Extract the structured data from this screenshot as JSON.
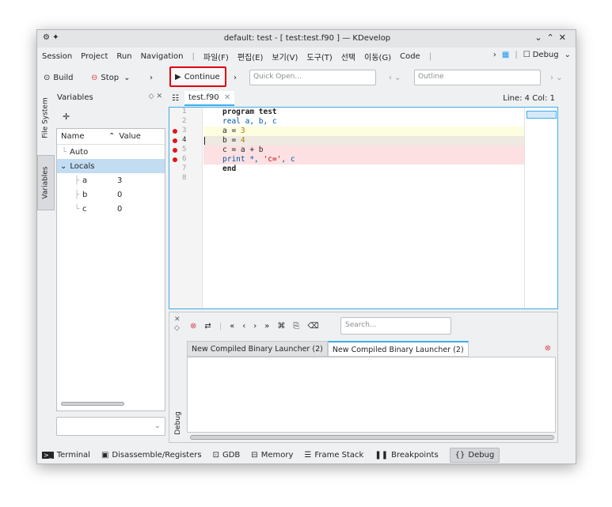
{
  "window": {
    "title": "default: test - [ test:test.f90 ] — KDevelop"
  },
  "menubar": {
    "items": [
      "Session",
      "Project",
      "Run",
      "Navigation",
      "|",
      "파일(F)",
      "편집(E)",
      "보기(V)",
      "도구(T)",
      "선택",
      "이동(G)",
      "Code",
      "|"
    ],
    "right_label": "Debug"
  },
  "toolbar": {
    "build": "Build",
    "stop": "Stop",
    "continue": "Continue",
    "quick_open_placeholder": "Quick Open...",
    "outline_placeholder": "Outline"
  },
  "left_tabs": {
    "file_system": "File System",
    "variables": "Variables"
  },
  "variables": {
    "title": "Variables",
    "columns": [
      "Name",
      "Value"
    ],
    "rows": [
      {
        "name": "Auto",
        "value": ""
      },
      {
        "name": "Locals",
        "value": ""
      },
      {
        "name": "a",
        "value": "3"
      },
      {
        "name": "b",
        "value": "0"
      },
      {
        "name": "c",
        "value": "0"
      }
    ]
  },
  "editor": {
    "tab": "test.f90",
    "position": "Line: 4 Col: 1",
    "lines": [
      {
        "n": "1",
        "text": "program test"
      },
      {
        "n": "2",
        "text": "real a, b, c"
      },
      {
        "n": "3",
        "text": "a = 3"
      },
      {
        "n": "4",
        "text": "b = 4"
      },
      {
        "n": "5",
        "text": "c = a + b"
      },
      {
        "n": "6",
        "text": "print *, 'c=', c"
      },
      {
        "n": "7",
        "text": "end"
      },
      {
        "n": "8",
        "text": ""
      }
    ]
  },
  "debug_panel": {
    "search_placeholder": "Search...",
    "tabs": [
      "New Compiled Binary Launcher (2)",
      "New Compiled Binary Launcher (2)"
    ],
    "side_label": "Debug"
  },
  "statusbar": {
    "items": [
      "Terminal",
      "Disassemble/Registers",
      "GDB",
      "Memory",
      "Frame Stack",
      "Breakpoints",
      "Debug"
    ]
  },
  "colors": {
    "accent": "#3daee9",
    "breakpoint": "#e0151b",
    "highlight_frame": "#e0000f"
  }
}
